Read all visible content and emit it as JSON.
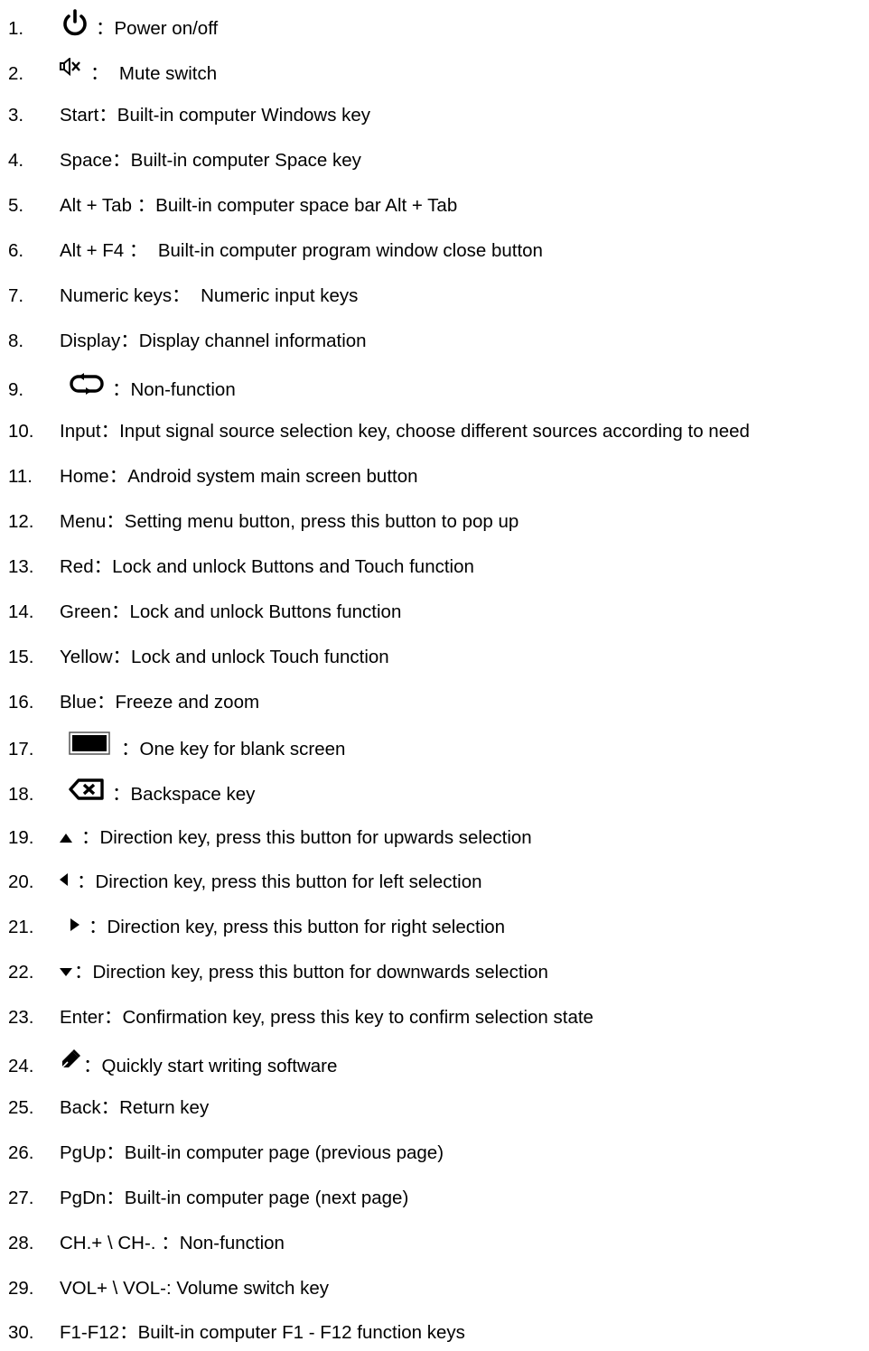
{
  "items": [
    {
      "num": "1.",
      "icon": "power-icon",
      "label": "",
      "sep": "：",
      "desc": "Power on/off"
    },
    {
      "num": "2.",
      "icon": "mute-icon",
      "label": "",
      "sep": "：  ",
      "desc": "Mute switch"
    },
    {
      "num": "3.",
      "icon": "",
      "label": "Start",
      "sep": "：",
      "desc": "Built-in computer Windows key"
    },
    {
      "num": "4.",
      "icon": "",
      "label": "Space",
      "sep": "：",
      "desc": "Built-in computer Space key"
    },
    {
      "num": "5.",
      "icon": "",
      "label": "Alt + Tab ",
      "sep": "：",
      "desc": "Built-in computer space bar Alt + Tab"
    },
    {
      "num": "6.",
      "icon": "",
      "label": "Alt + F4 ",
      "sep": "：  ",
      "desc": "Built-in computer program window close button"
    },
    {
      "num": "7.",
      "icon": "",
      "label": "Numeric keys",
      "sep": "：  ",
      "desc": "Numeric input keys"
    },
    {
      "num": "8.",
      "icon": "",
      "label": "Display",
      "sep": "：",
      "desc": "Display channel information"
    },
    {
      "num": "9.",
      "icon": "loop-icon",
      "label": "",
      "sep": "：",
      "desc": "Non-function"
    },
    {
      "num": "10.",
      "icon": "",
      "label": "Input",
      "sep": "：",
      "desc": "Input signal source selection key, choose different sources according to need"
    },
    {
      "num": "11.",
      "icon": "",
      "label": "Home",
      "sep": "：",
      "desc": "Android system main screen button"
    },
    {
      "num": "12.",
      "icon": "",
      "label": "Menu",
      "sep": "：",
      "desc": "Setting menu button, press this button to pop up"
    },
    {
      "num": "13.",
      "icon": "",
      "label": "Red",
      "sep": "：",
      "desc": "Lock and unlock Buttons and Touch function"
    },
    {
      "num": "14.",
      "icon": "",
      "label": "Green",
      "sep": "：",
      "desc": "Lock and unlock Buttons function"
    },
    {
      "num": "15.",
      "icon": "",
      "label": "Yellow",
      "sep": "：",
      "desc": "Lock and unlock Touch function"
    },
    {
      "num": "16.",
      "icon": "",
      "label": "Blue",
      "sep": "：",
      "desc": "Freeze and zoom"
    },
    {
      "num": "17.",
      "icon": "blank-screen-icon",
      "label": "",
      "sep": "：",
      "desc": "One key for blank screen"
    },
    {
      "num": "18.",
      "icon": "backspace-icon",
      "label": "",
      "sep": "：",
      "desc": "Backspace key"
    },
    {
      "num": "19.",
      "icon": "arrow-up-icon",
      "label": "",
      "sep": "：",
      "desc": "Direction key, press this button for upwards selection"
    },
    {
      "num": "20.",
      "icon": "arrow-left-icon",
      "label": "",
      "sep": "：",
      "desc": "Direction key, press this button for left selection"
    },
    {
      "num": "21.",
      "icon": "arrow-right-icon",
      "label": "",
      "sep": "：",
      "desc": "Direction key, press this button for right selection"
    },
    {
      "num": "22.",
      "icon": "arrow-down-icon",
      "label": "",
      "sep": "：",
      "desc": "Direction key, press this button for downwards selection"
    },
    {
      "num": "23.",
      "icon": "",
      "label": "Enter",
      "sep": "：",
      "desc": "Confirmation key, press this key to confirm selection state"
    },
    {
      "num": "24.",
      "icon": "pen-icon",
      "label": "",
      "sep": "：",
      "desc": "Quickly start writing software"
    },
    {
      "num": "25.",
      "icon": "",
      "label": "Back",
      "sep": "：",
      "desc": "Return key"
    },
    {
      "num": "26.",
      "icon": "",
      "label": "PgUp",
      "sep": "：",
      "desc": "Built-in computer page (previous page)"
    },
    {
      "num": "27.",
      "icon": "",
      "label": "PgDn",
      "sep": "：",
      "desc": "Built-in computer page (next page)"
    },
    {
      "num": "28.",
      "icon": "",
      "label": "CH.+ \\ CH-. ",
      "sep": "：",
      "desc": "Non-function"
    },
    {
      "num": "29.",
      "icon": "",
      "label": "VOL+ \\ VOL-",
      "sep": ": ",
      "desc": "Volume switch key"
    },
    {
      "num": "30.",
      "icon": "",
      "label": "F1-F12",
      "sep": "：",
      "desc": "Built-in computer F1 - F12 function keys"
    }
  ]
}
